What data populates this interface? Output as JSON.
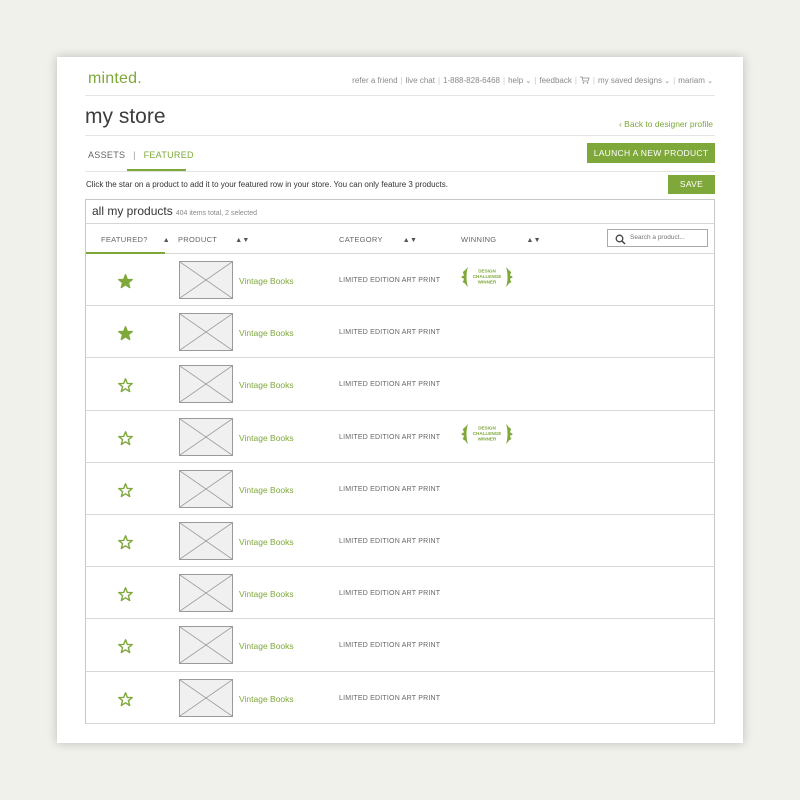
{
  "header": {
    "logo": "minted.",
    "nav": [
      {
        "label": "refer a friend",
        "caret": false
      },
      {
        "label": "live chat",
        "caret": false
      },
      {
        "label": "1-888-828-6468",
        "caret": false
      },
      {
        "label": "help",
        "caret": true
      },
      {
        "label": "feedback",
        "caret": false
      },
      {
        "label": "my saved designs",
        "caret": true,
        "icon": "cart-icon"
      },
      {
        "label": "mariam",
        "caret": true
      }
    ]
  },
  "page": {
    "title": "my store",
    "back_link": "Back to designer profile",
    "tabs": [
      {
        "label": "ASSETS",
        "active": false
      },
      {
        "label": "FEATURED",
        "active": true
      }
    ],
    "launch_button": "LAUNCH A NEW PRODUCT",
    "save_button": "SAVE",
    "instructions": "Click the star on a product to add it to your featured row in your store. You can only feature 3 products."
  },
  "panel": {
    "title": "all my products",
    "count_text": "404 items total, 2 selected",
    "columns": {
      "featured": "FEATURED?",
      "product": "PRODUCT",
      "category": "CATEGORY",
      "winning": "WINNING"
    },
    "search_placeholder": "Search a product..."
  },
  "badge_text": [
    "DESIGN",
    "CHALLENGE",
    "WINNER"
  ],
  "products": [
    {
      "name": "Vintage Books",
      "category": "LIMITED EDITION ART PRINT",
      "featured": true,
      "winner": true
    },
    {
      "name": "Vintage Books",
      "category": "LIMITED EDITION ART PRINT",
      "featured": true,
      "winner": false
    },
    {
      "name": "Vintage Books",
      "category": "LIMITED EDITION ART PRINT",
      "featured": false,
      "winner": false
    },
    {
      "name": "Vintage Books",
      "category": "LIMITED EDITION ART PRINT",
      "featured": false,
      "winner": true
    },
    {
      "name": "Vintage Books",
      "category": "LIMITED EDITION ART PRINT",
      "featured": false,
      "winner": false
    },
    {
      "name": "Vintage Books",
      "category": "LIMITED EDITION ART PRINT",
      "featured": false,
      "winner": false
    },
    {
      "name": "Vintage Books",
      "category": "LIMITED EDITION ART PRINT",
      "featured": false,
      "winner": false
    },
    {
      "name": "Vintage Books",
      "category": "LIMITED EDITION ART PRINT",
      "featured": false,
      "winner": false
    },
    {
      "name": "Vintage Books",
      "category": "LIMITED EDITION ART PRINT",
      "featured": false,
      "winner": false
    }
  ],
  "colors": {
    "accent": "#7fa83b",
    "text": "#333333",
    "muted": "#8a8a8a",
    "background": "#f1f1ec"
  }
}
